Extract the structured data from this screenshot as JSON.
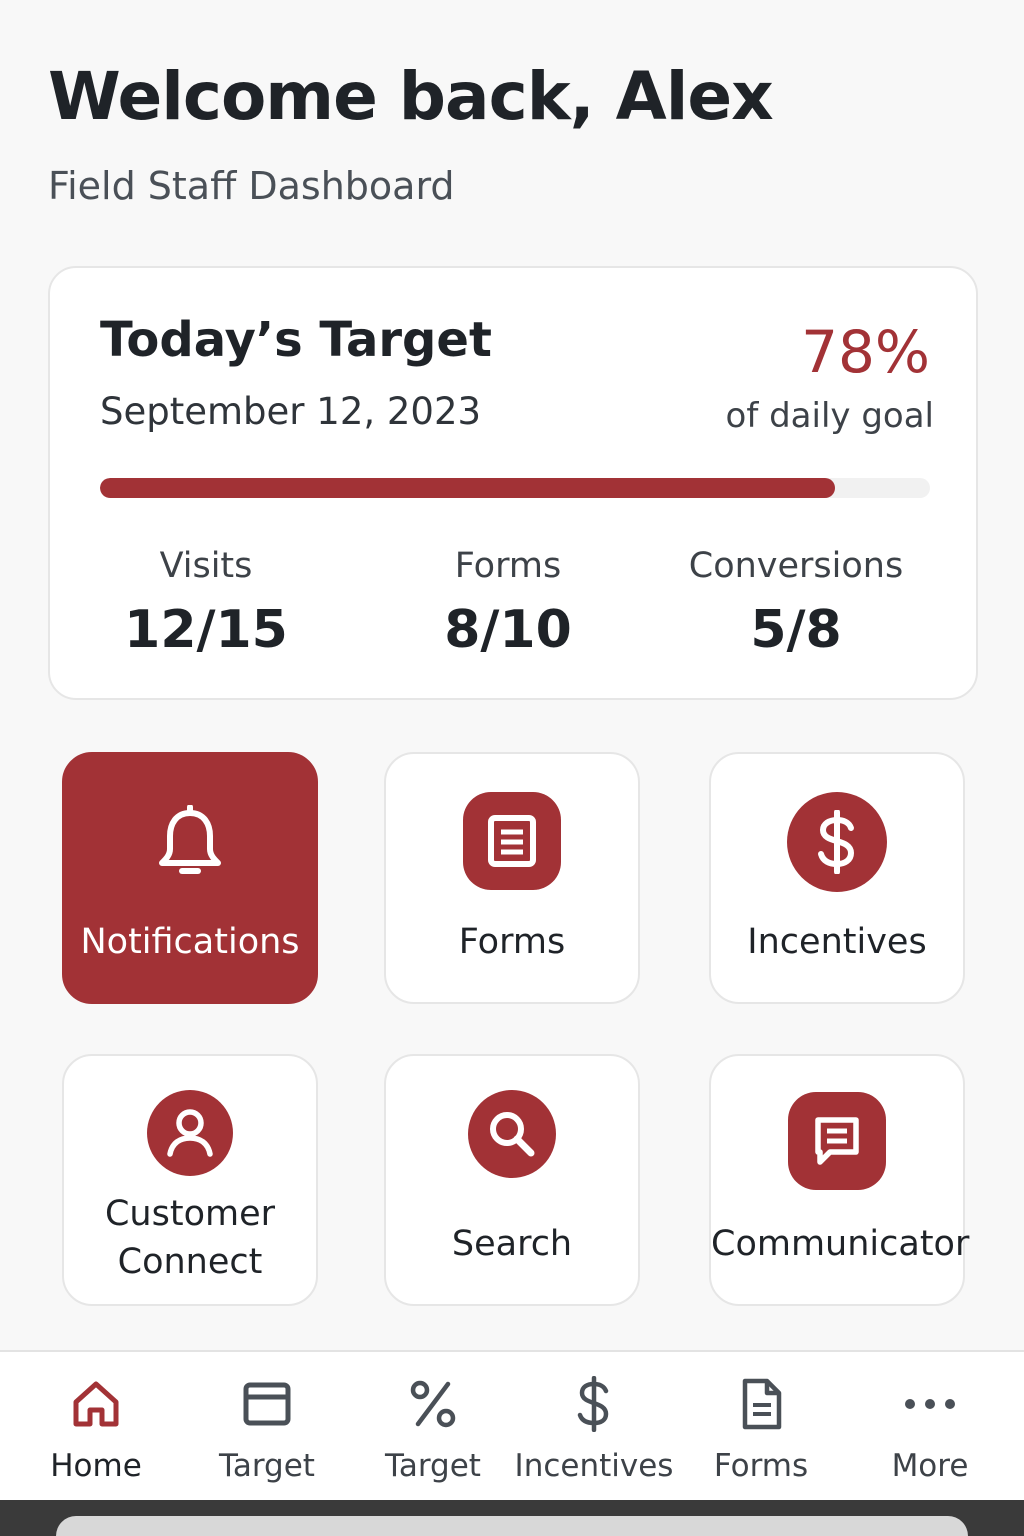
{
  "header": {
    "title": "Welcome back, Alex",
    "subtitle": "Field Staff Dashboard"
  },
  "target": {
    "title": "Today’s Target",
    "date": "September 12, 2023",
    "percent_label": "78%",
    "percent_caption": "of daily goal",
    "progress_fraction": 0.885,
    "stats": [
      {
        "label": "Visits",
        "value": "12/15"
      },
      {
        "label": "Forms",
        "value": "8/10"
      },
      {
        "label": "Conversions",
        "value": "5/8"
      }
    ]
  },
  "tiles": [
    {
      "label": "Notifications",
      "icon": "bell-icon",
      "active": true
    },
    {
      "label": "Forms",
      "icon": "form-document-icon",
      "active": false
    },
    {
      "label": "Incentives",
      "icon": "dollar-icon",
      "active": false
    },
    {
      "label_line1": "Customer",
      "label_line2": "Connect",
      "icon": "user-icon",
      "active": false
    },
    {
      "label": "Search",
      "icon": "search-icon",
      "active": false
    },
    {
      "label": "Communicator",
      "icon": "chat-icon",
      "active": false
    }
  ],
  "bottom_nav": [
    {
      "label": "Home",
      "icon": "home-icon",
      "active": true
    },
    {
      "label": "Target",
      "icon": "window-icon",
      "active": false
    },
    {
      "label": "Target",
      "icon": "percent-icon",
      "active": false
    },
    {
      "label": "Incentives",
      "icon": "dollar-icon",
      "active": false
    },
    {
      "label": "Forms",
      "icon": "document-icon",
      "active": false
    },
    {
      "label": "More",
      "icon": "more-dots-icon",
      "active": false
    }
  ],
  "colors": {
    "accent": "#a23236",
    "background": "#f8f8f8",
    "card": "#ffffff",
    "text": "#1f2328"
  }
}
